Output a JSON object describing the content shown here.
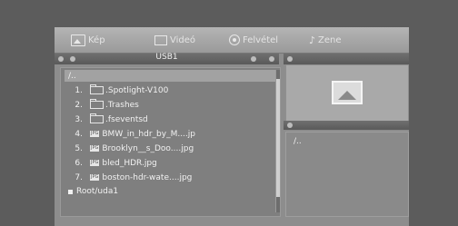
{
  "tabs": [
    {
      "label": "Kép",
      "icon": "photo-icon"
    },
    {
      "label": "Videó",
      "icon": "video-icon"
    },
    {
      "label": "Felvétel",
      "icon": "record-icon"
    },
    {
      "label": "Zene",
      "icon": "music-icon"
    }
  ],
  "browser": {
    "title": "USB1",
    "up_label": "/..",
    "items": [
      {
        "num": "1.",
        "type": "folder",
        "name": ".Spotlight-V100"
      },
      {
        "num": "2.",
        "type": "folder",
        "name": ".Trashes"
      },
      {
        "num": "3.",
        "type": "folder",
        "name": ".fseventsd"
      },
      {
        "num": "4.",
        "type": "jpg",
        "name": "BMW_in_hdr_by_M....jp"
      },
      {
        "num": "5.",
        "type": "jpg",
        "name": "Brooklyn__s_Doo....jpg"
      },
      {
        "num": "6.",
        "type": "jpg",
        "name": "bled_HDR.jpg"
      },
      {
        "num": "7.",
        "type": "jpg",
        "name": "boston-hdr-wate....jpg"
      }
    ],
    "jpg_badge": "JPG",
    "root_path": "Root/uda1"
  },
  "info_panel": {
    "path": "/.."
  }
}
